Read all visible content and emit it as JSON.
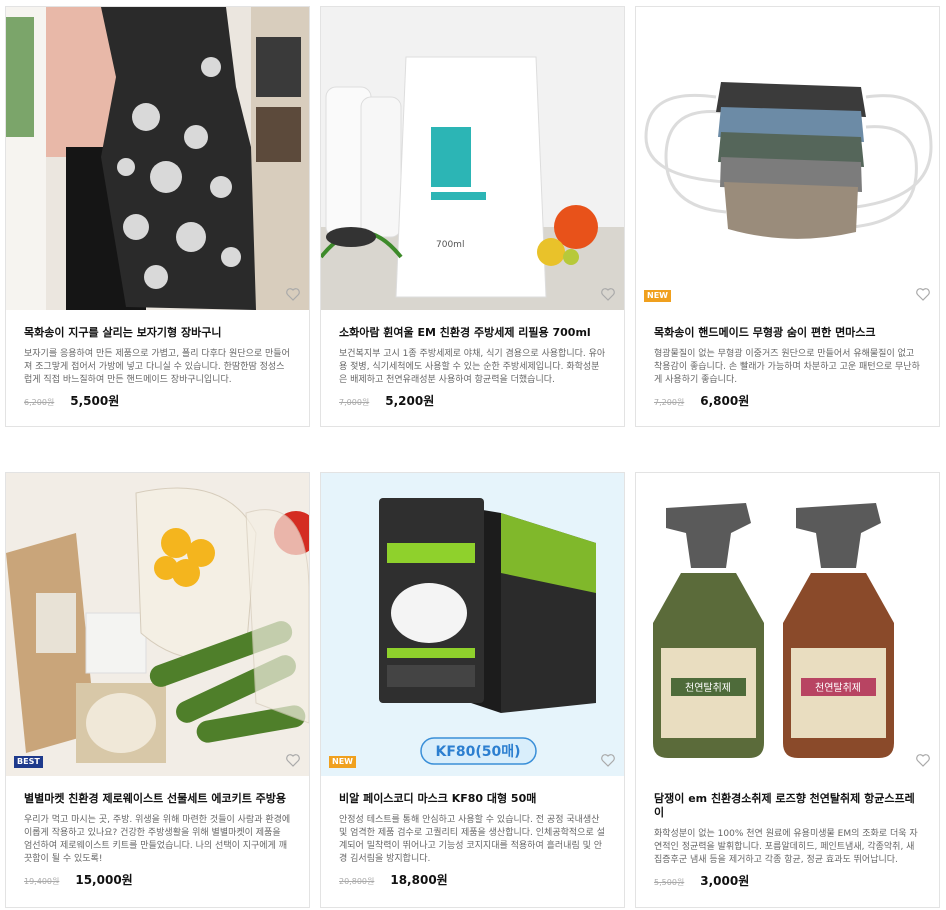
{
  "products": [
    {
      "name": "목화송이 지구를 살리는 보자기형 장바구니",
      "desc": "보자기를 응용하여 만든 제품으로 가볍고, 폴리 다후다 원단으로 만들어져 조그맣게 접어서 가방에 넣고 다니실 수 있습니다. 한땀한땀 정성스럽게 직접 바느질하여 만든 핸드메이드 장바구니입니다.",
      "orig_price": "6,200원",
      "price": "5,500원",
      "badge": ""
    },
    {
      "name": "소화아람 휜여울 EM 친환경 주방세제 리필용 700ml",
      "desc": "보건복지부 고시 1종 주방세제로 야채, 식기 겸용으로 사용합니다. 유아용 젖병, 식기세척에도 사용할 수 있는 순한 주방세제입니다. 화학성분은 배제하고 천연유래성분 사용하여 항균력을 더했습니다.",
      "orig_price": "7,000원",
      "price": "5,200원",
      "badge": "",
      "pack_label": "700ml"
    },
    {
      "name": "목화송이 핸드메이드 무형광 숨이 편한 면마스크",
      "desc": "형광물질이 없는 무형광 이중거즈 원단으로 만들어서 유해물질이 없고 착용감이 좋습니다. 손 빨래가 가능하며 차분하고 고운 패턴으로 무난하게 사용하기 좋습니다.",
      "orig_price": "7,200원",
      "price": "6,800원",
      "badge": "NEW"
    },
    {
      "name": "별별마켓 친환경 제로웨이스트 선물세트 에코키트 주방용",
      "desc": "우리가 먹고 마시는 곳, 주방. 위생을 위해 마련한 것들이 사람과 환경에 이롭게 작용하고 있나요? 건강한 주방생활을 위해 별별마켓이 제품을 엄선하여 제로웨이스트 키트를 만들었습니다. 나의 선택이 지구에게 깨끗함이 될 수 있도록!",
      "orig_price": "19,400원",
      "price": "15,000원",
      "badge": "BEST"
    },
    {
      "name": "비알 페이스코디 마스크 KF80 대형 50매",
      "desc": "안정성 테스트를 통해 안심하고 사용할 수 있습니다. 전 공정 국내생산 및 엄격한 제품 검수로 고퀄리티 제품을 생산합니다. 인체공학적으로 설계되어 밀착력이 뛰어나고 기능성 코지지대를 적용하여 흘러내림 및 안경 김서림을 방지합니다.",
      "orig_price": "20,800원",
      "price": "18,800원",
      "badge": "NEW",
      "pill_label": "KF80(50매)"
    },
    {
      "name": "담쟁이 em 친환경소취제 로즈향 천연탈취제 항균스프레이",
      "desc": "화학성분이 없는 100% 천연 원료에 유용미생물 EM의 조화로 더욱 자연적인 정균력을 발휘합니다. 포름알데히드, 페인트냄새, 각종악취, 새집증후군 냄새 등을 제거하고 각종 항균, 정균 효과도 뛰어납니다.",
      "orig_price": "5,500원",
      "price": "3,000원",
      "badge": "",
      "bottle_labels": [
        "천연탈취제",
        "천연탈취제"
      ]
    }
  ],
  "colors": {
    "new": "#f0a01e",
    "best": "#1e3a8c"
  },
  "icons": {
    "wish": "heart-icon"
  }
}
